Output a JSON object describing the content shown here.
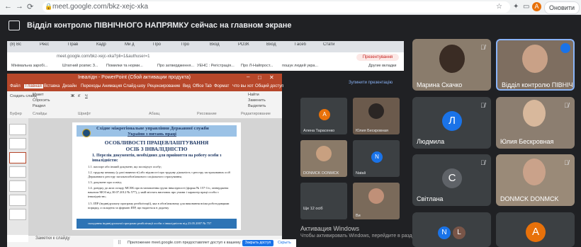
{
  "browser": {
    "url": "meet.google.com/bkz-xejc-xka",
    "update_button": "Оновити",
    "avatar_letter": "А"
  },
  "meet": {
    "presenting_text": "Відділ контролю ПІВНІЧНОГО НАПРЯМКУ сейчас на главном экране",
    "tiles": [
      {
        "name": "Марина Скачко",
        "muted": true
      },
      {
        "name": "Відділ контролю ПІВНІЧ...",
        "speaking": true
      },
      {
        "name": "Людмила",
        "letter": "Л",
        "color": "#1a73e8",
        "muted": true
      },
      {
        "name": "Юлия Бескровная",
        "muted": true
      },
      {
        "name": "Світлана",
        "letter": "С",
        "color": "#5f6368",
        "muted": true
      },
      {
        "name": "DONMCK DONMCK",
        "muted": true
      }
    ],
    "bottom_letters": [
      "N",
      "L"
    ],
    "bottom_avatar": "А"
  },
  "inner": {
    "tabs": [
      "(8) Вс",
      "Реєс",
      "Прав",
      "Кадр",
      "Ми д",
      "Про",
      "Про",
      "Вход",
      "РОЗК",
      "Вход",
      "Гасеб",
      "Стати"
    ],
    "url": "meet.google.com/bkz-xejc-xka?pli=1&authuser=1",
    "presenting_badge": "Презентування",
    "bookmarks": [
      "Мінімальна заробі...",
      "Штатний розпис З...",
      "Помилки та норми...",
      "Про затвердження...",
      "УЕНС : Регістрація...",
      "Про Л-Найпрост...",
      "пошук людей укра...",
      "Другие вкладки"
    ],
    "stop_presenting": "Зупинити презентацію",
    "tiles": [
      {
        "name": "Алена Тарасенко",
        "letter": "А"
      },
      {
        "name": "Юлия Бескровная"
      },
      {
        "name": "DONMCK DONMCK"
      },
      {
        "name": "Natali",
        "letter": "N"
      },
      {
        "name": "Ще 12 осіб"
      },
      {
        "name": "Ви"
      }
    ]
  },
  "ppt": {
    "title": "Інвалідн - PowerPoint (Сбой активации продукта)",
    "menu": [
      "Файл",
      "Главная",
      "Вставка",
      "Дизайн",
      "Переходы",
      "Анимация",
      "Слайд-шоу",
      "Рецензирование",
      "Вид",
      "Office Tab",
      "Формат",
      "Что вы хотите сделать?",
      "Общий доступ"
    ],
    "ribbon": [
      "Создать слайд",
      "Макет",
      "Сбросить",
      "Раздел",
      "Буфер",
      "Слайды",
      "Шрифт",
      "Абзац",
      "Рисование",
      "Найти",
      "Заменить",
      "Выделить",
      "Редактирование"
    ],
    "notes": "Заметки к слайду",
    "slide": {
      "banner1": "Східне міжрегіональне управління Державної служби",
      "banner2": "України з питань праці",
      "title1": "ОСОБЛИВОСТІ ПРАЦЕВЛАШТУВАННЯ",
      "title2": "ОСІБ З ІНВАЛІДНІСТЮ",
      "subtitle": "1.   Перелік документів, необхідних для прийняття на роботу особи з інвалідністю:",
      "lines": [
        "1.1. паспорт або інший документ, що посвідчує особу;",
        "1.2. трудову книжку (у разі наявності) або відомості про трудову діяльність з реєстру застрахованих осіб Державного реєстру загальнообов'язкового соціального страхування;",
        "1.3. документ про освіту;",
        "1.4. довідку до акта огляду МСЕК про встановлення групи інвалідності (форма № 157-1/о, затверджена наказом МОЗ від 30.07.2012 № 577), у якій містять висновок про умови і характер праці особи з інвалідністю;",
        "1.5. ІПР (індивідуальну програму реабілітації), яка в обов'язковому для виконання всіма роботодавцями порядку, а складена за формою ІПР, що надається в додатку",
        "складання індивідуальної програми реабілітації особи з інвалідністю від 23.05.2007 № 757"
      ]
    }
  },
  "share": {
    "text": "Приложение meet.google.com предоставляет доступ к вашему экрану.",
    "stop": "Закрыть доступ",
    "hide": "Скрыть"
  },
  "activation": {
    "line1": "Активация Windows",
    "line2": "Чтобы активировать Windows, перейдите в раздел \"Параметры\""
  }
}
